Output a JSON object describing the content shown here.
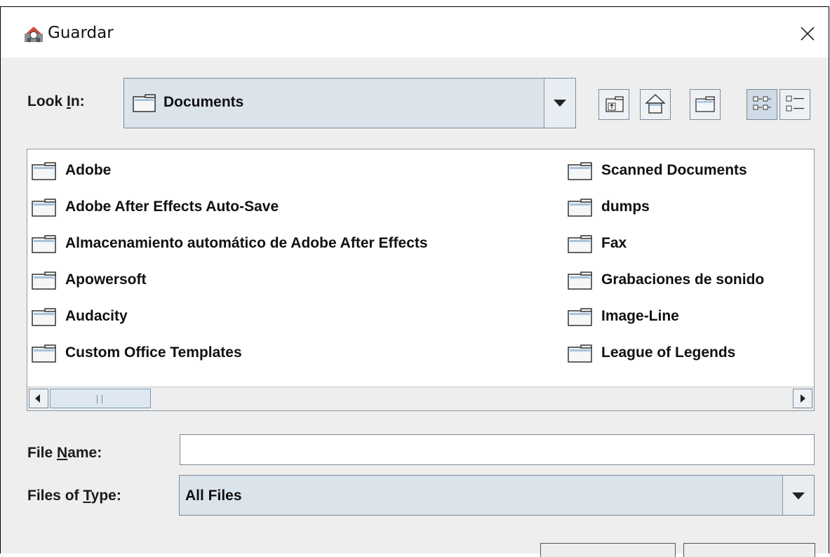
{
  "window": {
    "title": "Guardar"
  },
  "look_in": {
    "label_prefix": "Look ",
    "label_mnemonic": "I",
    "label_suffix": "n:",
    "value": "Documents"
  },
  "toolbar": {
    "buttons": [
      "up-one-level-icon",
      "home-icon",
      "new-folder-icon",
      "list-view-icon",
      "details-view-icon"
    ]
  },
  "files": {
    "left": [
      "Adobe",
      "Adobe After Effects Auto-Save",
      "Almacenamiento automático de Adobe After Effects",
      "Apowersoft",
      "Audacity",
      "Custom Office Templates"
    ],
    "right": [
      "Scanned Documents",
      "dumps",
      "Fax",
      "Grabaciones de sonido",
      "Image-Line",
      "League of Legends"
    ]
  },
  "file_name": {
    "label_prefix": "File ",
    "label_mnemonic": "N",
    "label_suffix": "ame:",
    "value": ""
  },
  "file_type": {
    "label_prefix": "Files of ",
    "label_mnemonic": "T",
    "label_suffix": "ype:",
    "value": "All Files"
  },
  "colors": {
    "combo_bg": "#dbe3eb",
    "border": "#7a8a99",
    "dialog_bg": "#eeeeee"
  }
}
